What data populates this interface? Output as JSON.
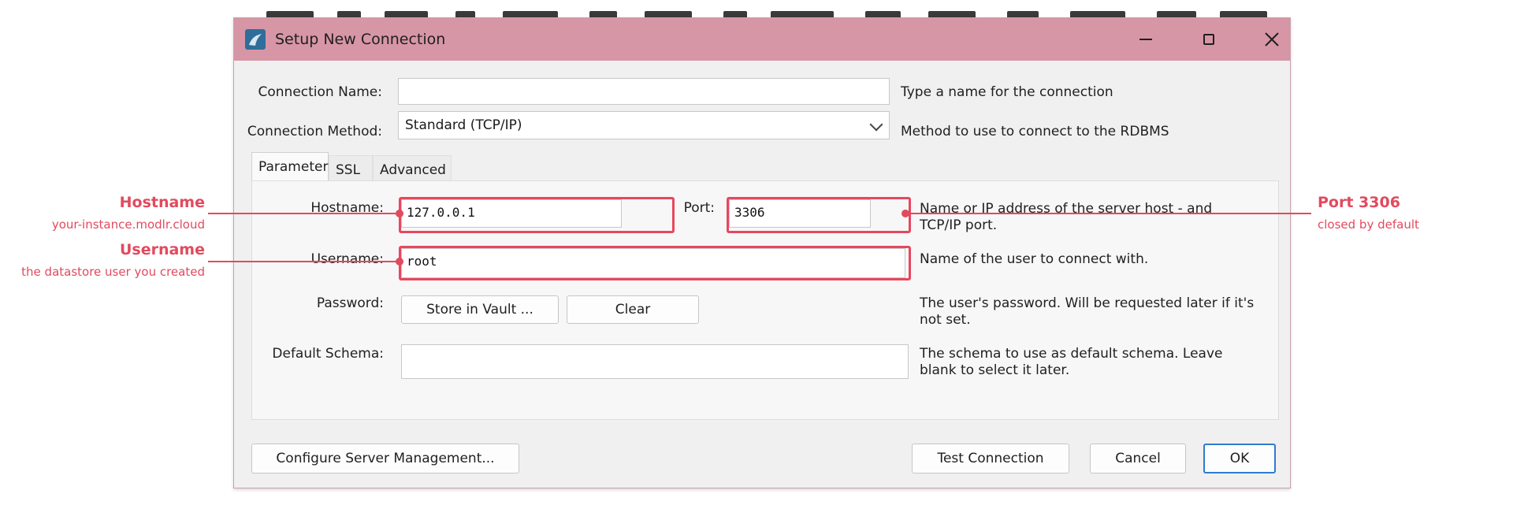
{
  "dialog": {
    "title": "Setup New Connection",
    "connection_name_label": "Connection Name:",
    "connection_name_value": "",
    "connection_name_hint": "Type a name for the connection",
    "connection_method_label": "Connection Method:",
    "connection_method_value": "Standard (TCP/IP)",
    "connection_method_hint": "Method to use to connect to the RDBMS",
    "tabs": [
      {
        "label": "Parameters",
        "active": true
      },
      {
        "label": "SSL",
        "active": false
      },
      {
        "label": "Advanced",
        "active": false
      }
    ],
    "hostname_label": "Hostname:",
    "hostname_value": "127.0.0.1",
    "port_label": "Port:",
    "port_value": "3306",
    "host_hint_line1": "Name or IP address of the server host - and",
    "host_hint_line2": "TCP/IP port.",
    "username_label": "Username:",
    "username_value": "root",
    "username_hint": "Name of the user to connect with.",
    "password_label": "Password:",
    "store_vault_label": "Store in Vault ...",
    "clear_label": "Clear",
    "password_hint_line1": "The user's password. Will be requested later if it's",
    "password_hint_line2": "not set.",
    "default_schema_label": "Default Schema:",
    "default_schema_value": "",
    "schema_hint_line1": "The schema to use as default schema. Leave",
    "schema_hint_line2": "blank to select it later.",
    "configure_server_label": "Configure Server Management...",
    "test_connection_label": "Test Connection",
    "cancel_label": "Cancel",
    "ok_label": "OK"
  },
  "annotations": {
    "hostname_title": "Hostname",
    "hostname_sub": "your-instance.modlr.cloud",
    "username_title": "Username",
    "username_sub": "the datastore user you created",
    "port_title": "Port 3306",
    "port_sub": "closed by default"
  },
  "colors": {
    "titlebar": "#d796a6",
    "highlight": "#e8475f",
    "annotation": "#e24a5e",
    "primary_border": "#2e7bd1"
  }
}
